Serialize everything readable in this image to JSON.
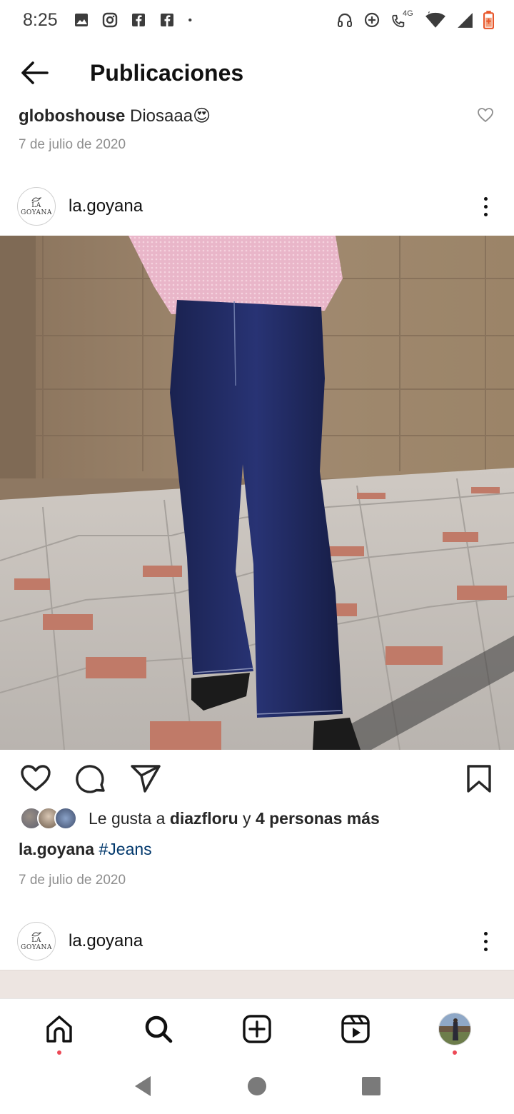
{
  "status_bar": {
    "time": "8:25",
    "network": "4G",
    "left_icons": [
      "image-icon",
      "instagram-icon",
      "facebook-icon",
      "facebook-icon",
      "dot-icon"
    ],
    "right_icons": [
      "headphones-icon",
      "data-saver-icon",
      "call-4g-icon",
      "wifi-icon",
      "signal-icon",
      "battery-icon"
    ],
    "battery_color": "#e8562a"
  },
  "header": {
    "title": "Publicaciones"
  },
  "comment": {
    "username": "globoshouse",
    "text": "Diosaaa",
    "emoji": "😍",
    "date": "7 de julio de 2020"
  },
  "post": {
    "username": "la.goyana",
    "avatar_logo_lines": [
      "LA",
      "GOYANA"
    ],
    "likes": {
      "prefix": "Le gusta a",
      "user": "diazfloru",
      "connector": "y",
      "others": "4 personas más"
    },
    "caption": {
      "username": "la.goyana",
      "hashtag": "#Jeans"
    },
    "date": "7 de julio de 2020"
  },
  "next_post": {
    "username": "la.goyana"
  },
  "bottom_nav": [
    "home-icon",
    "search-icon",
    "new-post-icon",
    "reels-icon",
    "profile-avatar"
  ],
  "colors": {
    "text": "#262626",
    "secondary": "#8e8e8e",
    "hashtag": "#00376b",
    "notification_dot": "#ed4956"
  }
}
